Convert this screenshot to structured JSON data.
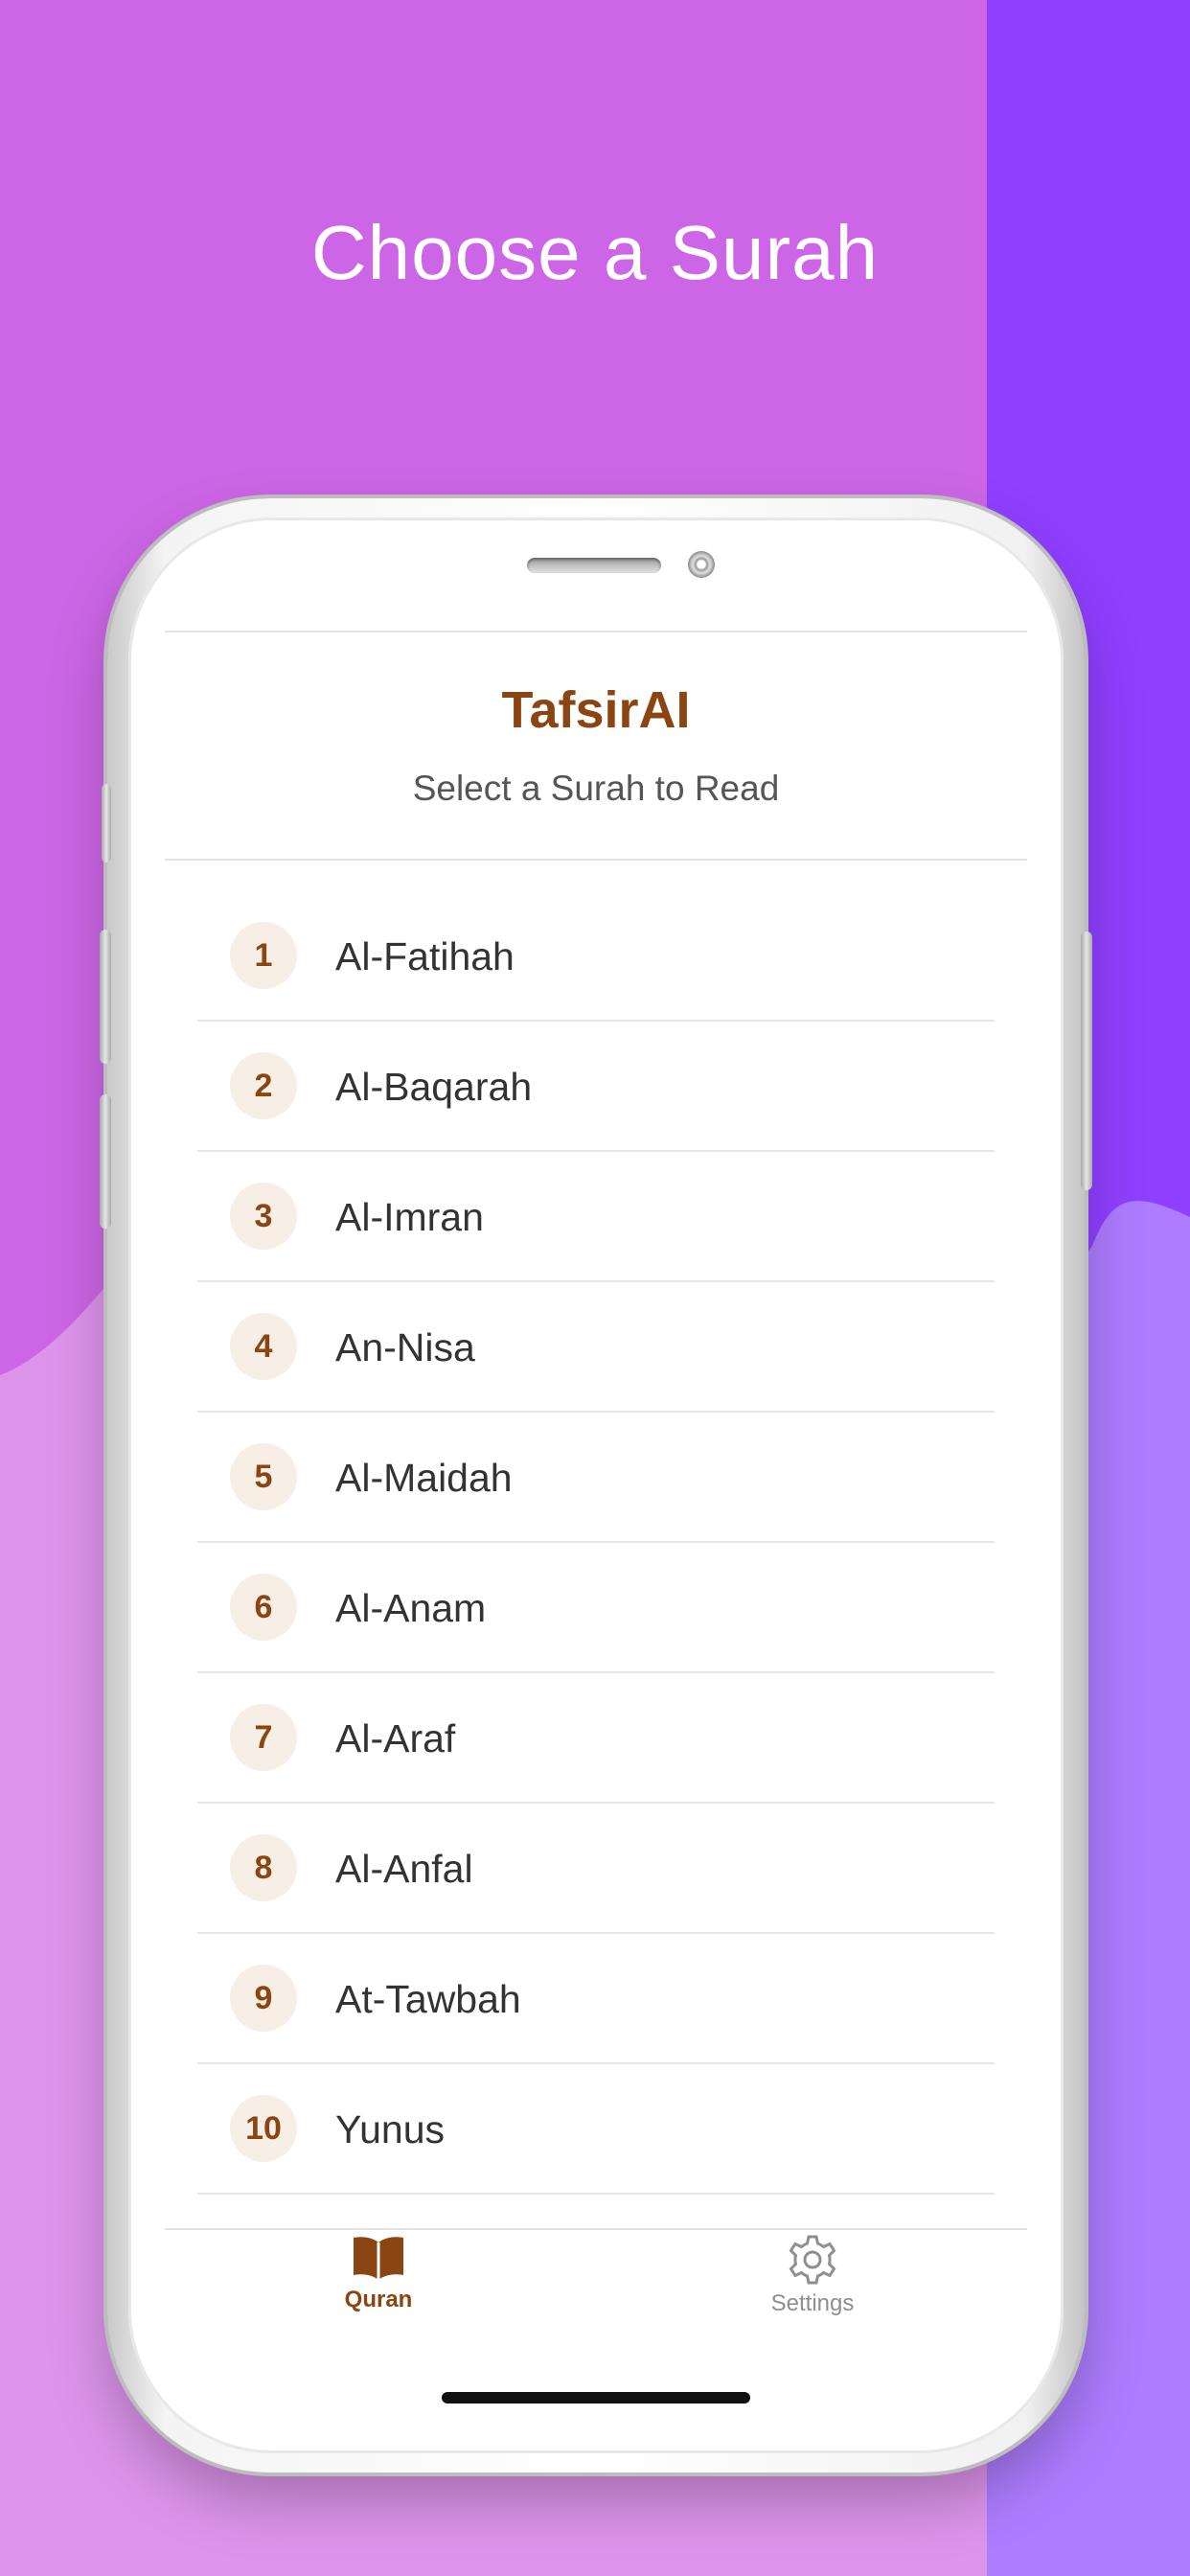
{
  "headline": "Choose a Surah",
  "app": {
    "title": "TafsirAI",
    "subtitle": "Select a Surah to Read"
  },
  "surahs": [
    {
      "number": "1",
      "name": "Al-Fatihah"
    },
    {
      "number": "2",
      "name": "Al-Baqarah"
    },
    {
      "number": "3",
      "name": "Al-Imran"
    },
    {
      "number": "4",
      "name": "An-Nisa"
    },
    {
      "number": "5",
      "name": "Al-Maidah"
    },
    {
      "number": "6",
      "name": "Al-Anam"
    },
    {
      "number": "7",
      "name": "Al-Araf"
    },
    {
      "number": "8",
      "name": "Al-Anfal"
    },
    {
      "number": "9",
      "name": "At-Tawbah"
    },
    {
      "number": "10",
      "name": "Yunus"
    }
  ],
  "tabbar": {
    "quran_label": "Quran",
    "settings_label": "Settings",
    "quran_icon": "open-book-icon",
    "settings_icon": "gear-icon",
    "active_tab": "Quran"
  },
  "colors": {
    "background_magenta": "#cc66e6",
    "background_violet": "#8f3fff",
    "accent_brown": "#8b4513",
    "badge_bg": "#f7efe6",
    "inactive_tab": "#8e8e93"
  }
}
